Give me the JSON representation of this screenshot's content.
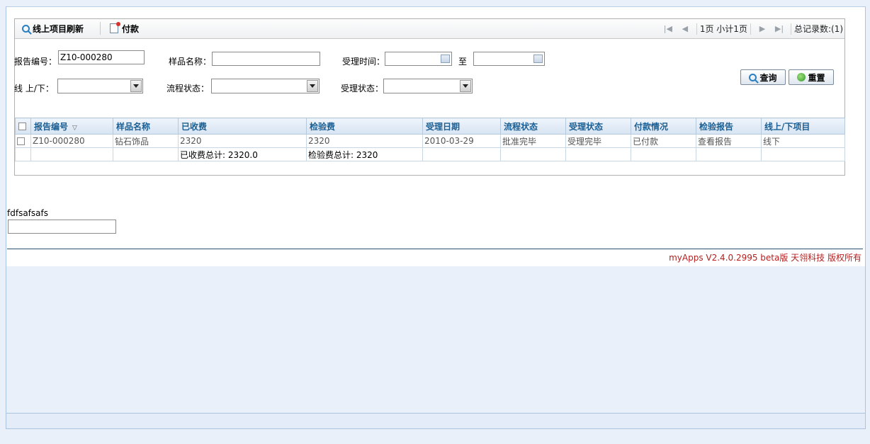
{
  "toolbar": {
    "refresh_label": "线上项目刷新",
    "pay_label": "付款"
  },
  "pager": {
    "page_info": "1页 小计1页",
    "total_records": "总记录数:(1)"
  },
  "filters": {
    "report_no_label": "报告编号：",
    "report_no_value": "Z10-000280",
    "sample_name_label": "样品名称：",
    "sample_name_value": "",
    "accept_time_label": "受理时间：",
    "accept_time_from": "",
    "to_label": "至",
    "accept_time_to": "",
    "online_label": "线 上/下：",
    "online_value": "",
    "flow_status_label": "流程状态：",
    "flow_status_value": "",
    "accept_status_label": "受理状态：",
    "accept_status_value": ""
  },
  "buttons": {
    "query": "查询",
    "reset": "重置"
  },
  "grid": {
    "columns": [
      "报告编号",
      "样品名称",
      "已收费",
      "检验费",
      "受理日期",
      "流程状态",
      "受理状态",
      "付款情况",
      "检验报告",
      "线上/下项目"
    ],
    "rows": [
      [
        "Z10-000280",
        "钻石饰品",
        "2320",
        "2320",
        "2010-03-29",
        "批准完毕",
        "受理完毕",
        "已付款",
        "查看报告",
        "线下"
      ]
    ],
    "summary": {
      "received_total": "已收费总计: 2320.0",
      "fee_total": "检验费总计: 2320"
    }
  },
  "extra": {
    "label": "fdfsafsafs",
    "value": ""
  },
  "footer": {
    "text": "myApps V2.4.0.2995 beta版  天翎科技  版权所有"
  }
}
